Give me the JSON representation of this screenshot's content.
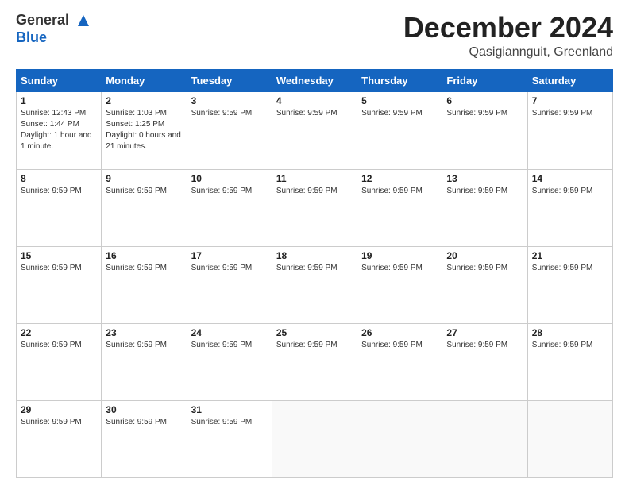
{
  "header": {
    "logo_line1": "General",
    "logo_line2": "Blue",
    "month": "December 2024",
    "location": "Qasigiannguit, Greenland"
  },
  "weekdays": [
    "Sunday",
    "Monday",
    "Tuesday",
    "Wednesday",
    "Thursday",
    "Friday",
    "Saturday"
  ],
  "weeks": [
    [
      {
        "day": "1",
        "info": "Sunrise: 12:43 PM\nSunset: 1:44 PM\nDaylight: 1 hour and 1 minute."
      },
      {
        "day": "2",
        "info": "Sunrise: 1:03 PM\nSunset: 1:25 PM\nDaylight: 0 hours and 21 minutes."
      },
      {
        "day": "3",
        "info": "Sunrise: 9:59 PM"
      },
      {
        "day": "4",
        "info": "Sunrise: 9:59 PM"
      },
      {
        "day": "5",
        "info": "Sunrise: 9:59 PM"
      },
      {
        "day": "6",
        "info": "Sunrise: 9:59 PM"
      },
      {
        "day": "7",
        "info": "Sunrise: 9:59 PM"
      }
    ],
    [
      {
        "day": "8",
        "info": "Sunrise: 9:59 PM"
      },
      {
        "day": "9",
        "info": "Sunrise: 9:59 PM"
      },
      {
        "day": "10",
        "info": "Sunrise: 9:59 PM"
      },
      {
        "day": "11",
        "info": "Sunrise: 9:59 PM"
      },
      {
        "day": "12",
        "info": "Sunrise: 9:59 PM"
      },
      {
        "day": "13",
        "info": "Sunrise: 9:59 PM"
      },
      {
        "day": "14",
        "info": "Sunrise: 9:59 PM"
      }
    ],
    [
      {
        "day": "15",
        "info": "Sunrise: 9:59 PM"
      },
      {
        "day": "16",
        "info": "Sunrise: 9:59 PM"
      },
      {
        "day": "17",
        "info": "Sunrise: 9:59 PM"
      },
      {
        "day": "18",
        "info": "Sunrise: 9:59 PM"
      },
      {
        "day": "19",
        "info": "Sunrise: 9:59 PM"
      },
      {
        "day": "20",
        "info": "Sunrise: 9:59 PM"
      },
      {
        "day": "21",
        "info": "Sunrise: 9:59 PM"
      }
    ],
    [
      {
        "day": "22",
        "info": "Sunrise: 9:59 PM"
      },
      {
        "day": "23",
        "info": "Sunrise: 9:59 PM"
      },
      {
        "day": "24",
        "info": "Sunrise: 9:59 PM"
      },
      {
        "day": "25",
        "info": "Sunrise: 9:59 PM"
      },
      {
        "day": "26",
        "info": "Sunrise: 9:59 PM"
      },
      {
        "day": "27",
        "info": "Sunrise: 9:59 PM"
      },
      {
        "day": "28",
        "info": "Sunrise: 9:59 PM"
      }
    ],
    [
      {
        "day": "29",
        "info": "Sunrise: 9:59 PM"
      },
      {
        "day": "30",
        "info": "Sunrise: 9:59 PM"
      },
      {
        "day": "31",
        "info": "Sunrise: 9:59 PM"
      },
      {
        "day": "",
        "info": ""
      },
      {
        "day": "",
        "info": ""
      },
      {
        "day": "",
        "info": ""
      },
      {
        "day": "",
        "info": ""
      }
    ]
  ]
}
